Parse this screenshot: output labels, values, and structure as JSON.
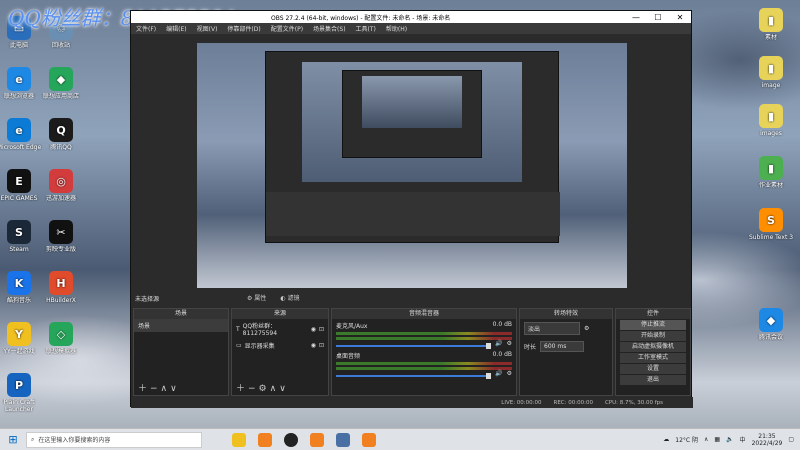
{
  "watermark": "QQ粉丝群：811275594",
  "desktop_left": [
    {
      "label": "此电脑",
      "color": "#2a6ebb",
      "glyph": "▭"
    },
    {
      "label": "回收站",
      "color": "#6b8fb3",
      "glyph": "♲"
    },
    {
      "label": "联想浏览器",
      "color": "#1e88e5",
      "glyph": "e"
    },
    {
      "label": "联想应用商店",
      "color": "#26a65b",
      "glyph": "◆"
    },
    {
      "label": "Microsoft Edge",
      "color": "#0c7bd6",
      "glyph": "e"
    },
    {
      "label": "腾讯QQ",
      "color": "#1b1b1b",
      "glyph": "Q"
    },
    {
      "label": "EPIC GAMES",
      "color": "#111111",
      "glyph": "E"
    },
    {
      "label": "迅游加速器",
      "color": "#d23c3c",
      "glyph": "◎"
    },
    {
      "label": "Steam",
      "color": "#1b2838",
      "glyph": "S"
    },
    {
      "label": "剪映专业版",
      "color": "#111111",
      "glyph": "✂"
    },
    {
      "label": "酷狗音乐",
      "color": "#1a73e8",
      "glyph": "K"
    },
    {
      "label": "HBuilderX",
      "color": "#e04b2b",
      "glyph": "H"
    },
    {
      "label": "YY一起游戏",
      "color": "#f0c020",
      "glyph": "Y"
    },
    {
      "label": "联想模拟器",
      "color": "#26a65b",
      "glyph": "◇"
    },
    {
      "label": "Plain Craft Launcher",
      "color": "#1565c0",
      "glyph": "P"
    }
  ],
  "desktop_right": [
    {
      "label": "素材",
      "color": "#e8d35a",
      "glyph": "▮"
    },
    {
      "label": "image",
      "color": "#e8d35a",
      "glyph": "▮"
    },
    {
      "label": "images",
      "color": "#e8d35a",
      "glyph": "▮"
    },
    {
      "label": "作业素材",
      "color": "#4caf50",
      "glyph": "▮"
    },
    {
      "label": "Sublime Text 3",
      "color": "#ff8f00",
      "glyph": "S"
    },
    {
      "label": "腾讯会议",
      "color": "#1e88e5",
      "glyph": "◆"
    }
  ],
  "obs": {
    "title": "OBS 27.2.4 (64-bit, windows) - 配置文件: 未命名 - 场景: 未命名",
    "menu": [
      "文件(F)",
      "编辑(E)",
      "视图(V)",
      "停靠部件(D)",
      "配置文件(P)",
      "场景集合(S)",
      "工具(T)",
      "帮助(H)"
    ],
    "no_scene": "未选择源",
    "properties_btn": "属性",
    "filters_btn": "滤镜",
    "scenes": {
      "header": "场景",
      "items": [
        "场景"
      ]
    },
    "sources": {
      "header": "来源",
      "items": [
        "QQ粉丝群：811275594",
        "显示器采集"
      ]
    },
    "mixer": {
      "header": "音频混音器",
      "tracks": [
        {
          "name": "麦克风/Aux",
          "db": "0.0 dB"
        },
        {
          "name": "桌面音频",
          "db": "0.0 dB"
        }
      ]
    },
    "transitions": {
      "header": "转场特效",
      "type": "淡出",
      "duration_label": "时长",
      "duration": "600 ms"
    },
    "controls": {
      "header": "控件",
      "buttons": [
        "停止推流",
        "开始录制",
        "启动虚拟摄像机",
        "工作室模式",
        "设置",
        "退出"
      ]
    },
    "status": {
      "live": "LIVE: 00:00:00",
      "rec": "REC: 00:00:00",
      "cpu": "CPU: 8.7%, 30.00 fps"
    }
  },
  "taskbar": {
    "search_placeholder": "在这里输入你要搜索的内容",
    "weather": "12°C 阴",
    "lang": "中",
    "time": "21:35",
    "date": "2022/4/29"
  }
}
